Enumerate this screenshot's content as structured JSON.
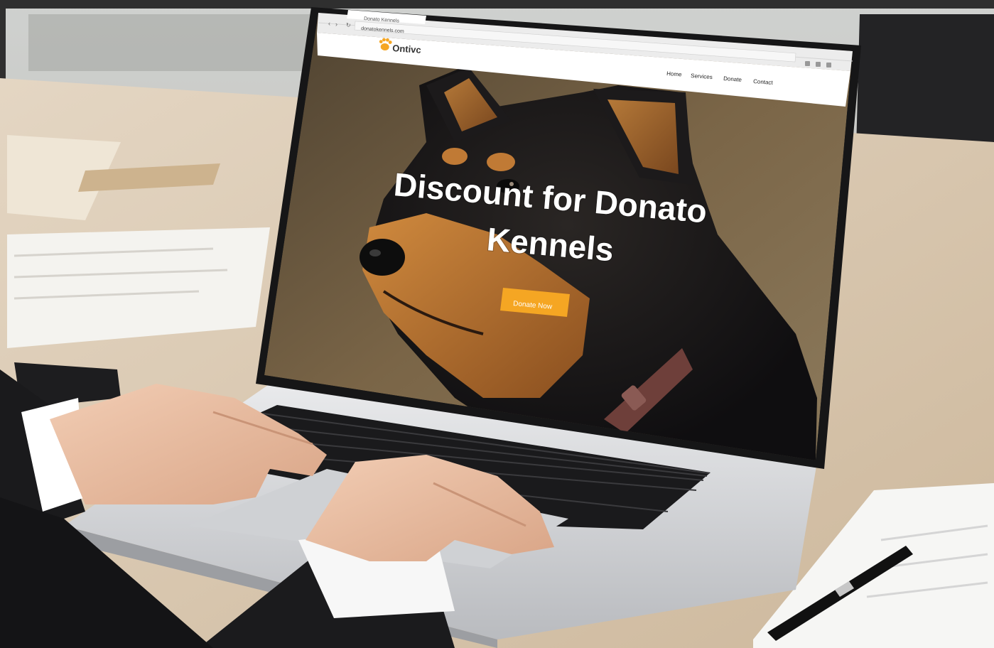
{
  "browser": {
    "tab_title": "Donato Kennels",
    "address_bar_url": "donatokennels.com"
  },
  "site": {
    "logo_text": "Ontivc",
    "nav": [
      "Home",
      "Services",
      "Donate",
      "Contact"
    ],
    "hero_title_line1": "Discount for Donato",
    "hero_title_line2": "Kennels",
    "cta_label": "Donate Now"
  },
  "colors": {
    "accent": "#f5a623",
    "screen_bg": "#6b5a43",
    "dog_black": "#17161a",
    "dog_tan": "#b56a2a",
    "desk": "#d8c8b3"
  },
  "icons": [
    "paw-icon",
    "back-arrow-icon",
    "forward-arrow-icon",
    "reload-icon",
    "pen-icon"
  ]
}
